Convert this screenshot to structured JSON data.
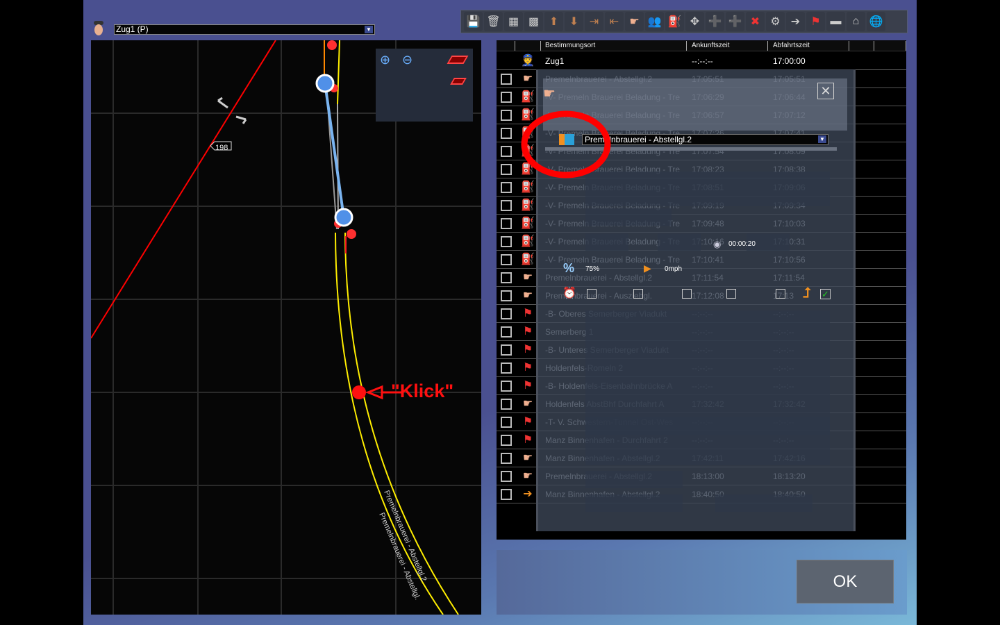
{
  "train_selector": {
    "value": "Zug1 (P)"
  },
  "map": {
    "signal_label": "198",
    "track_labels": [
      "Premelnbrauerei - Abstellgl.2",
      "Premelnbrauerei - Abstellgl."
    ],
    "annotation": "\"Klick\""
  },
  "toolbar": {
    "icons": [
      "save-icon",
      "trash-icon",
      "grid-gray-icon",
      "grid-green-icon",
      "move-up-icon",
      "move-down-icon",
      "insert-after-icon",
      "insert-before-icon",
      "hand-icon",
      "passengers-icon",
      "loader-icon",
      "expand-icon",
      "add-after-icon",
      "add-before-icon",
      "remove-icon",
      "settings-icon",
      "door-icon",
      "flag-icon",
      "train-icon",
      "station-icon",
      "globe-icon"
    ]
  },
  "table": {
    "headers": [
      "Bestimmungsort",
      "Ankunftszeit",
      "Abfahrtszeit"
    ],
    "train_row": {
      "dest": "Zug1",
      "arr": "--:--:--",
      "dep": "17:00:00"
    },
    "rows": [
      {
        "icon": "hand",
        "dest": "Premelnbrauerei - Abstellgl.2",
        "arr": "17:05:51",
        "dep": "17:05:51"
      },
      {
        "icon": "loader",
        "dest": "-V- Premeln Brauerei Beladung - Tre",
        "arr": "17:06:29",
        "dep": "17:06:44"
      },
      {
        "icon": "loader",
        "dest": "-V- Premeln Brauerei Beladung - Tre",
        "arr": "17:06:57",
        "dep": "17:07:12"
      },
      {
        "icon": "loader",
        "dest": "-V- Premeln Brauerei Beladung - Tre",
        "arr": "17:07:26",
        "dep": "17:07:41"
      },
      {
        "icon": "loader",
        "dest": "-V- Premeln Brauerei Beladung - Tre",
        "arr": "17:07:54",
        "dep": "17:08:09"
      },
      {
        "icon": "loader",
        "dest": "-V- Premeln Brauerei Beladung - Tre",
        "arr": "17:08:23",
        "dep": "17:08:38"
      },
      {
        "icon": "loader",
        "dest": "-V- Premeln Brauerei Beladung - Tre",
        "arr": "17:08:51",
        "dep": "17:09:06"
      },
      {
        "icon": "loader",
        "dest": "-V- Premeln Brauerei Beladung - Tre",
        "arr": "17:09:19",
        "dep": "17:09:34"
      },
      {
        "icon": "loader",
        "dest": "-V- Premeln Brauerei Beladung - Tre",
        "arr": "17:09:48",
        "dep": "17:10:03"
      },
      {
        "icon": "loader",
        "dest": "-V- Premeln Brauerei Beladung - Tre",
        "arr": "17:10:16",
        "dep": "17:10:31"
      },
      {
        "icon": "loader",
        "dest": "-V- Premeln Brauerei Beladung - Tre",
        "arr": "17:10:41",
        "dep": "17:10:56"
      },
      {
        "icon": "hand",
        "dest": "Premelnbrauerei - Abstellgl.2",
        "arr": "17:11:54",
        "dep": "17:11:54"
      },
      {
        "icon": "hand",
        "dest": "Premelnbrauerei - Ausziehgl.",
        "arr": "17:12:08",
        "dep": "17:13"
      },
      {
        "icon": "flag",
        "dest": "-B- Oberes Semerberger Viadukt",
        "arr": "--:--:--",
        "dep": "--:--:--"
      },
      {
        "icon": "flag",
        "dest": "Semerberg 1",
        "arr": "--:--:--",
        "dep": "--:--:--"
      },
      {
        "icon": "flag",
        "dest": "-B- Unteres Semerberger Viadukt",
        "arr": "--:--:--",
        "dep": "--:--:--"
      },
      {
        "icon": "flag",
        "dest": "Holdenfels-Romeln 2",
        "arr": "--:--:--",
        "dep": "--:--:--"
      },
      {
        "icon": "flag",
        "dest": "-B- Holdenfels-Eisenbahnbrücke A",
        "arr": "--:--:--",
        "dep": "--:--:--"
      },
      {
        "icon": "hand",
        "dest": "Holdenfels AbstBhf Durchfahrt A",
        "arr": "17:32:42",
        "dep": "17:32:42"
      },
      {
        "icon": "flag",
        "dest": "-T- V. Schwestern-Tunnel Ost-Wes",
        "arr": "--:--:--",
        "dep": "--:--:--"
      },
      {
        "icon": "flag",
        "dest": "Manz Binnenhafen - Durchfahrt 2",
        "arr": "--:--:--",
        "dep": "--:--:--"
      },
      {
        "icon": "hand",
        "dest": "Manz Binnenhafen - Abstellgl.2",
        "arr": "17:42:11",
        "dep": "17:42:16"
      },
      {
        "icon": "hand",
        "dest": "Premelnbrauerei - Abstellgl.2",
        "arr": "18:13:00",
        "dep": "18:13:20"
      },
      {
        "icon": "door",
        "dest": "Manz Binnenhafen - Abstellgl.2",
        "arr": "18:40:50",
        "dep": "18:40:50"
      }
    ]
  },
  "dialog": {
    "destination_select": "Premelnbrauerei - Abstellgl.2",
    "wait_time": "00:00:20",
    "load_percent": "75%",
    "speed": "0mph"
  },
  "ok_label": "OK",
  "colors": {
    "window": "#4a5090",
    "track": "#ffee00",
    "route": "#ff0000",
    "marker": "#5090e8"
  }
}
